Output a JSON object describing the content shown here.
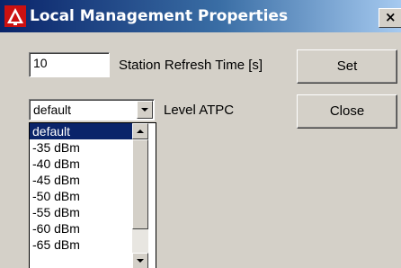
{
  "window": {
    "title": "Local Management Properties",
    "close_glyph": "×",
    "icon": "warning-triangle-logo-icon"
  },
  "refresh": {
    "value": "10",
    "label": "Station Refresh Time [s]",
    "set_button": "Set"
  },
  "level": {
    "selected": "default",
    "label": "Level ATPC",
    "close_button": "Close",
    "options": [
      "default",
      "-35 dBm",
      "-40 dBm",
      "-45 dBm",
      "-50 dBm",
      "-55 dBm",
      "-60 dBm",
      "-65 dBm"
    ]
  },
  "colors": {
    "titlebar": "#0a246a",
    "face": "#d4d0c8",
    "selection": "#0a246a"
  }
}
